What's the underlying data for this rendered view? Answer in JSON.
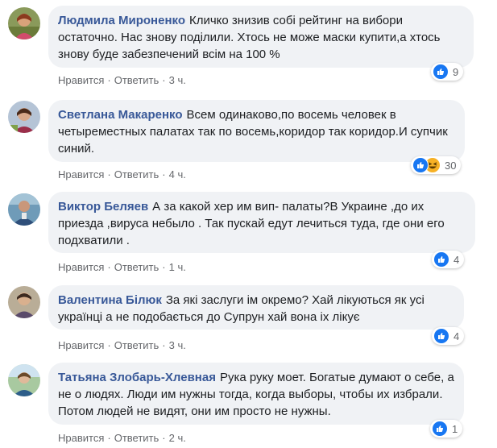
{
  "comments": [
    {
      "author": "Людмила Мироненко",
      "text": "Кличко знизив собі рейтинг на вибори остаточно. Нас знову поділили. Хтось не може маски купити,а хтось знову буде забезпечений всім на 100 %",
      "like": "Нравится",
      "reply": "Ответить",
      "time": "3 ч.",
      "reaction_count": "9",
      "reactions": [
        "like"
      ]
    },
    {
      "author": "Светлана Макаренко",
      "text": "Всем одинаково,по восемь человек в четыреместных палатах так по восемь,коридор так коридор.И супчик синий.",
      "like": "Нравится",
      "reply": "Ответить",
      "time": "4 ч.",
      "reaction_count": "30",
      "reactions": [
        "like",
        "haha"
      ]
    },
    {
      "author": "Виктор Беляев",
      "text": "А за какой хер им вип- палаты?В Украине ,до их приезда ,вируса небыло . Так пускай едут лечиться туда, где они его подхватили .",
      "like": "Нравится",
      "reply": "Ответить",
      "time": "1 ч.",
      "reaction_count": "4",
      "reactions": [
        "like"
      ]
    },
    {
      "author": "Валентина Білюк",
      "text": "За які заслуги ім окремо? Хай лікуються як усі українці а не подобається до Супрун хай вона іх лікує",
      "like": "Нравится",
      "reply": "Ответить",
      "time": "3 ч.",
      "reaction_count": "4",
      "reactions": [
        "like"
      ]
    },
    {
      "author": "Татьяна Злобарь-Хлевная",
      "text": "Рука руку моет. Богатые думают о себе, а не о людях. Люди им нужны тогда, когда выборы, чтобы их избрали. Потом людей не видят, они им просто не нужны.",
      "like": "Нравится",
      "reply": "Ответить",
      "time": "2 ч.",
      "reaction_count": "1",
      "reactions": [
        "like"
      ]
    }
  ],
  "colors": {
    "bubble": "#f0f2f5",
    "author": "#385898",
    "like_blue": "#1877f2",
    "haha_yellow": "#f7b125",
    "meta_gray": "#65676b"
  }
}
